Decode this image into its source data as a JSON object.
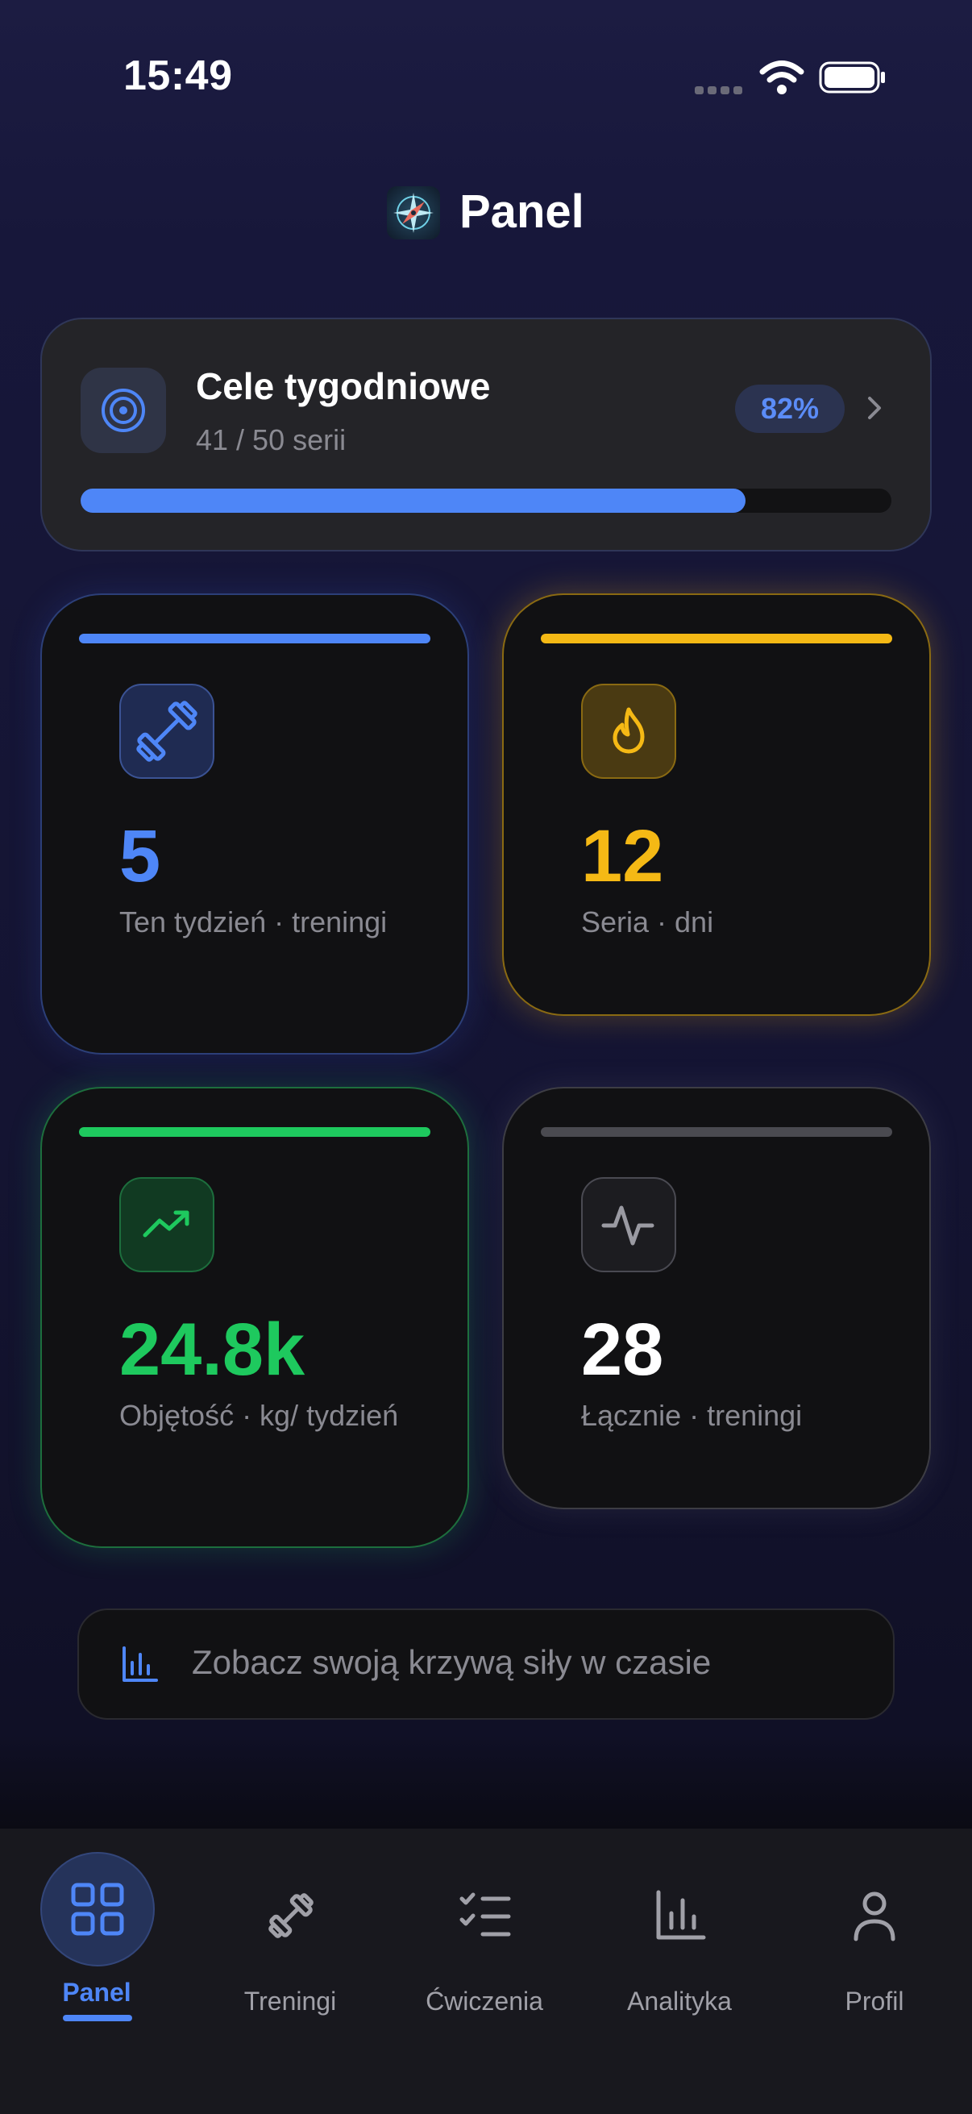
{
  "status_bar": {
    "time": "15:49"
  },
  "header": {
    "title": "Panel",
    "logo_icon": "compass-icon"
  },
  "goals": {
    "title": "Cele tygodniowe",
    "subtitle": "41 / 50 serii",
    "percent_label": "82%",
    "progress": 0.82
  },
  "stats": [
    {
      "value": "5",
      "label": "Ten tydzień · treningi",
      "icon": "dumbbell-icon",
      "color": "#4e86f7"
    },
    {
      "value": "12",
      "label": "Seria · dni",
      "icon": "flame-icon",
      "color": "#f5b915"
    },
    {
      "value": "24.8k",
      "label": "Objętość · kg/ tydzień",
      "icon": "trending-up-icon",
      "color": "#1ec95e"
    },
    {
      "value": "28",
      "label": "Łącznie · treningi",
      "icon": "activity-icon",
      "color": "#ffffff"
    }
  ],
  "strength_curve": {
    "label": "Zobacz swoją krzywą siły w czasie",
    "icon": "bar-chart-icon"
  },
  "tabs": [
    {
      "label": "Panel",
      "icon": "dashboard-icon",
      "active": true
    },
    {
      "label": "Treningi",
      "icon": "dumbbell-icon"
    },
    {
      "label": "Ćwiczenia",
      "icon": "checklist-icon"
    },
    {
      "label": "Analityka",
      "icon": "bar-chart-icon"
    },
    {
      "label": "Profil",
      "icon": "user-icon"
    }
  ],
  "colors": {
    "accent": "#4e86f7",
    "background": "#17173a",
    "tabbar": "#18181e"
  }
}
